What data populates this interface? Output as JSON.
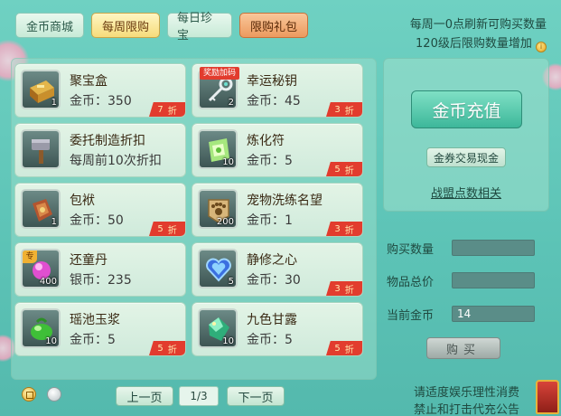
{
  "tabs": [
    {
      "label": "金币商城",
      "active": false
    },
    {
      "label": "每周限购",
      "active": true
    },
    {
      "label": "每日珍宝",
      "active": false
    },
    {
      "label": "限购礼包",
      "active": false
    }
  ],
  "notice": {
    "line1": "每周一0点刷新可购买数量",
    "line2": "120级后限购数量增加"
  },
  "items": [
    {
      "name": "聚宝盒",
      "price": "金币：350",
      "count": "1",
      "discount": "7",
      "discount_unit": "折",
      "icon": "treasure-box"
    },
    {
      "name": "幸运秘钥",
      "price": "金币：45",
      "count": "2",
      "discount": "3",
      "discount_unit": "折",
      "icon": "lucky-key",
      "ribbon": "奖励加码"
    },
    {
      "name": "委托制造折扣",
      "price": "每周前10次折扣",
      "count": "",
      "discount": "",
      "discount_unit": "",
      "icon": "hammer"
    },
    {
      "name": "炼化符",
      "price": "金币：5",
      "count": "10",
      "discount": "5",
      "discount_unit": "折",
      "icon": "refine-talisman"
    },
    {
      "name": "包袱",
      "price": "金币：50",
      "count": "1",
      "discount": "5",
      "discount_unit": "折",
      "icon": "bag"
    },
    {
      "name": "宠物洗练名望",
      "price": "金币：1",
      "count": "200",
      "discount": "3",
      "discount_unit": "折",
      "icon": "paw-badge"
    },
    {
      "name": "还童丹",
      "price": "银币：235",
      "count": "400",
      "discount": "",
      "discount_unit": "",
      "icon": "pink-pill",
      "tag": "专"
    },
    {
      "name": "静修之心",
      "price": "金币：30",
      "count": "5",
      "discount": "3",
      "discount_unit": "折",
      "icon": "heart-gem"
    },
    {
      "name": "瑶池玉浆",
      "price": "金币：5",
      "count": "10",
      "discount": "5",
      "discount_unit": "折",
      "icon": "green-jade"
    },
    {
      "name": "九色甘露",
      "price": "金币：5",
      "count": "10",
      "discount": "5",
      "discount_unit": "折",
      "icon": "dew-crystal"
    }
  ],
  "right": {
    "recharge": "金币充值",
    "exchange": "金券交易现金",
    "alliance": "战盟点数相关"
  },
  "form": {
    "qty_label": "购买数量",
    "qty_value": "",
    "total_label": "物品总价",
    "total_value": "",
    "gold_label": "当前金币",
    "gold_value": "14",
    "buy": "购买"
  },
  "pager": {
    "prev": "上一页",
    "indicator": "1/3",
    "next": "下一页"
  },
  "footer": {
    "line1": "请适度娱乐理性消费",
    "line2": "禁止和打击代充公告"
  },
  "colors": {
    "background": "#5cc3b6",
    "discount_red": "#e23c2e",
    "active_tab": "#f6dc7b"
  }
}
